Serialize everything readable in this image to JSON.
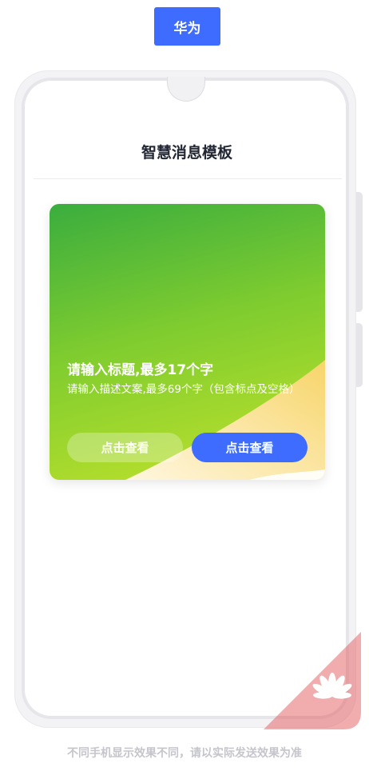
{
  "top": {
    "brand_tab_label": "华为"
  },
  "screen": {
    "title": "智慧消息模板"
  },
  "card": {
    "title": "请输入标题,最多17个字",
    "description": "请输入描述文案,最多69个字（包含标点及空格）",
    "button_secondary_label": "点击查看",
    "button_primary_label": "点击查看"
  },
  "footer": {
    "note": "不同手机显示效果不同，请以实际发送效果为准"
  },
  "colors": {
    "accent": "#3d6cff",
    "card_gradient_start": "#3aad3e",
    "card_gradient_end": "#c3e32c",
    "wave": "#f7d56a",
    "corner_mark": "#e0494b"
  },
  "icons": {
    "corner": "huawei-logo-icon"
  }
}
